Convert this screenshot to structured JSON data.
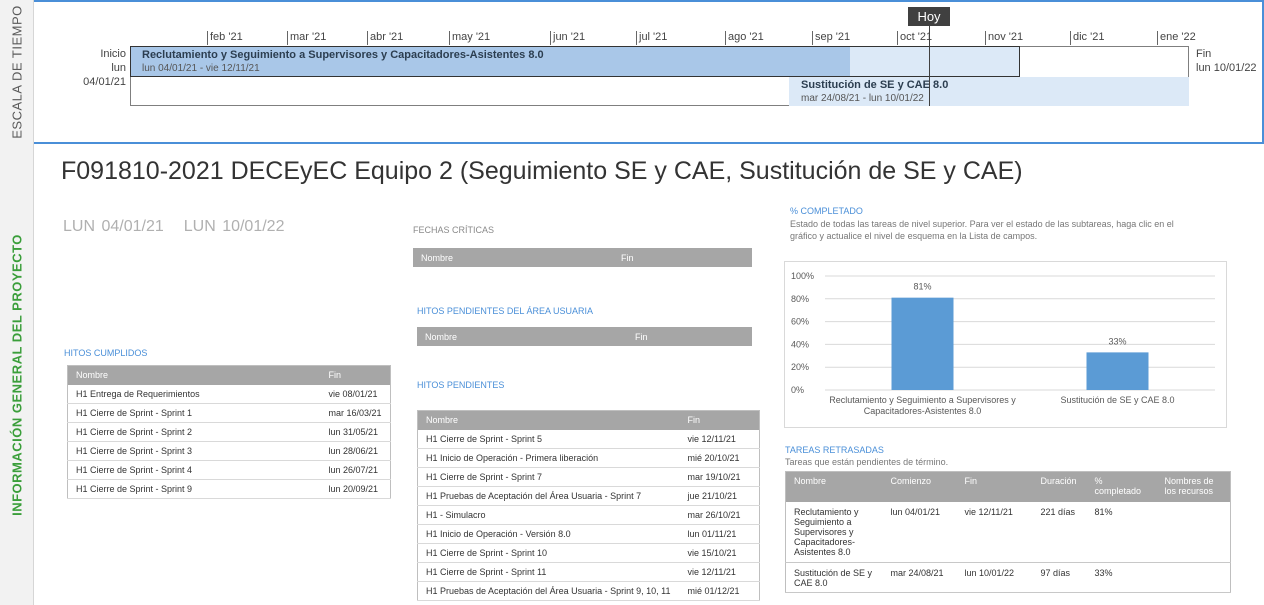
{
  "timeline": {
    "side_label": "ESCALA DE TIEMPO",
    "months": [
      "feb '21",
      "mar '21",
      "abr '21",
      "may '21",
      "jun '21",
      "jul '21",
      "ago '21",
      "sep '21",
      "oct '21",
      "nov '21",
      "dic '21",
      "ene '22"
    ],
    "today_label": "Hoy",
    "start_label": "Inicio",
    "start_date": "lun 04/01/21",
    "end_label": "Fin",
    "end_date": "lun 10/01/22",
    "bars": [
      {
        "title": "Reclutamiento y Seguimiento a Supervisores y Capacitadores-Asistentes 8.0",
        "dates": "lun 04/01/21 - vie 12/11/21"
      },
      {
        "title": "Sustitución de SE y CAE 8.0",
        "dates": "mar 24/08/21 - lun 10/01/22"
      }
    ]
  },
  "info": {
    "side_label": "INFORMACIÓN GENERAL DEL PROYECTO",
    "project_title": "F091810-2021 DECEyEC Equipo 2 (Seguimiento SE y CAE, Sustitución de SE y CAE)",
    "start_date": "LUN 04/01/21",
    "end_date": "LUN 10/01/22"
  },
  "critical_dates": {
    "heading": "FECHAS CRÍTICAS",
    "columns": [
      "Nombre",
      "Fin"
    ]
  },
  "pending_user_milestones": {
    "heading": "HITOS PENDIENTES DEL ÁREA USUARIA",
    "columns": [
      "Nombre",
      "Fin"
    ]
  },
  "completed_milestones": {
    "heading": "HITOS CUMPLIDOS",
    "columns": [
      "Nombre",
      "Fin"
    ],
    "rows": [
      [
        "H1 Entrega de Requerimientos",
        "vie 08/01/21"
      ],
      [
        "H1 Cierre de Sprint - Sprint 1",
        "mar 16/03/21"
      ],
      [
        "H1 Cierre de Sprint - Sprint 2",
        "lun 31/05/21"
      ],
      [
        "H1 Cierre de Sprint - Sprint 3",
        "lun 28/06/21"
      ],
      [
        "H1 Cierre de Sprint - Sprint 4",
        "lun 26/07/21"
      ],
      [
        "H1 Cierre de Sprint - Sprint 9",
        "lun 20/09/21"
      ]
    ]
  },
  "pending_milestones": {
    "heading": "HITOS PENDIENTES",
    "columns": [
      "Nombre",
      "Fin"
    ],
    "rows": [
      [
        "H1 Cierre de Sprint - Sprint 5",
        "vie 12/11/21"
      ],
      [
        "H1 Inicio de Operación - Primera liberación",
        "mié 20/10/21"
      ],
      [
        "H1 Cierre de Sprint - Sprint 7",
        "mar 19/10/21"
      ],
      [
        " H1 Pruebas de Aceptación del Área Usuaria - Sprint 7",
        "jue 21/10/21"
      ],
      [
        "H1 - Simulacro",
        "mar 26/10/21"
      ],
      [
        "H1 Inicio de Operación - Versión 8.0",
        "lun 01/11/21"
      ],
      [
        "H1 Cierre de Sprint - Sprint 10",
        "vie 15/10/21"
      ],
      [
        "H1 Cierre de Sprint - Sprint 11",
        "vie 12/11/21"
      ],
      [
        "H1 Pruebas de Aceptación del Área Usuaria - Sprint 9, 10, 11",
        "mié 01/12/21"
      ]
    ]
  },
  "percent_complete": {
    "heading": "% COMPLETADO",
    "description": "Estado de todas las tareas de nivel superior. Para ver el estado de las subtareas, haga clic en el gráfico y actualice el nivel de esquema en la Lista de campos."
  },
  "chart_data": {
    "type": "bar",
    "categories": [
      "Reclutamiento y Seguimiento a Supervisores y Capacitadores-Asistentes 8.0",
      "Sustitución de SE y CAE 8.0"
    ],
    "category_lines": [
      [
        "Reclutamiento y Seguimiento a Supervisores y",
        "Capacitadores-Asistentes 8.0"
      ],
      [
        "Sustitución de SE y CAE 8.0"
      ]
    ],
    "values": [
      81,
      33
    ],
    "value_labels": [
      "81%",
      "33%"
    ],
    "y_ticks": [
      "0%",
      "20%",
      "40%",
      "60%",
      "80%",
      "100%"
    ],
    "ylim": [
      0,
      100
    ],
    "grid": true,
    "bar_color": "#5b9bd5",
    "title": "",
    "xlabel": "",
    "ylabel": ""
  },
  "late_tasks": {
    "heading": "TAREAS RETRASADAS",
    "description": "Tareas que están pendientes de término.",
    "columns": [
      "Nombre",
      "Comienzo",
      "Fin",
      "Duración",
      "% completado",
      "Nombres de los recursos"
    ],
    "rows": [
      [
        "Reclutamiento y Seguimiento a Supervisores y Capacitadores-Asistentes 8.0",
        "lun 04/01/21",
        "vie 12/11/21",
        "221 días",
        "81%",
        ""
      ],
      [
        "Sustitución de SE y CAE 8.0",
        "mar 24/08/21",
        "lun 10/01/22",
        "97 días",
        "33%",
        ""
      ]
    ]
  },
  "colors": {
    "accent": "#4a8fd8",
    "section_green": "#3a9e3a",
    "header_gray": "#a6a6a6",
    "bar1": "#a9c7e8",
    "bar2": "#dce9f7",
    "today_flag": "#404040"
  }
}
